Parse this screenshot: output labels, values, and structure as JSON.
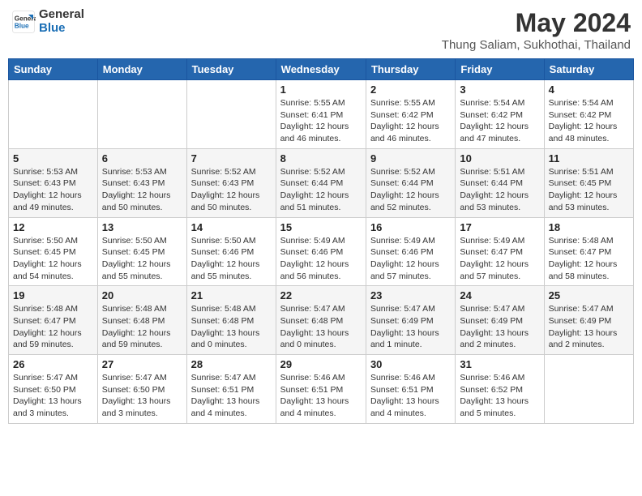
{
  "header": {
    "logo_general": "General",
    "logo_blue": "Blue",
    "main_title": "May 2024",
    "subtitle": "Thung Saliam, Sukhothai, Thailand"
  },
  "calendar": {
    "days_of_week": [
      "Sunday",
      "Monday",
      "Tuesday",
      "Wednesday",
      "Thursday",
      "Friday",
      "Saturday"
    ],
    "weeks": [
      [
        {
          "day": "",
          "info": ""
        },
        {
          "day": "",
          "info": ""
        },
        {
          "day": "",
          "info": ""
        },
        {
          "day": "1",
          "info": "Sunrise: 5:55 AM\nSunset: 6:41 PM\nDaylight: 12 hours\nand 46 minutes."
        },
        {
          "day": "2",
          "info": "Sunrise: 5:55 AM\nSunset: 6:42 PM\nDaylight: 12 hours\nand 46 minutes."
        },
        {
          "day": "3",
          "info": "Sunrise: 5:54 AM\nSunset: 6:42 PM\nDaylight: 12 hours\nand 47 minutes."
        },
        {
          "day": "4",
          "info": "Sunrise: 5:54 AM\nSunset: 6:42 PM\nDaylight: 12 hours\nand 48 minutes."
        }
      ],
      [
        {
          "day": "5",
          "info": "Sunrise: 5:53 AM\nSunset: 6:43 PM\nDaylight: 12 hours\nand 49 minutes."
        },
        {
          "day": "6",
          "info": "Sunrise: 5:53 AM\nSunset: 6:43 PM\nDaylight: 12 hours\nand 50 minutes."
        },
        {
          "day": "7",
          "info": "Sunrise: 5:52 AM\nSunset: 6:43 PM\nDaylight: 12 hours\nand 50 minutes."
        },
        {
          "day": "8",
          "info": "Sunrise: 5:52 AM\nSunset: 6:44 PM\nDaylight: 12 hours\nand 51 minutes."
        },
        {
          "day": "9",
          "info": "Sunrise: 5:52 AM\nSunset: 6:44 PM\nDaylight: 12 hours\nand 52 minutes."
        },
        {
          "day": "10",
          "info": "Sunrise: 5:51 AM\nSunset: 6:44 PM\nDaylight: 12 hours\nand 53 minutes."
        },
        {
          "day": "11",
          "info": "Sunrise: 5:51 AM\nSunset: 6:45 PM\nDaylight: 12 hours\nand 53 minutes."
        }
      ],
      [
        {
          "day": "12",
          "info": "Sunrise: 5:50 AM\nSunset: 6:45 PM\nDaylight: 12 hours\nand 54 minutes."
        },
        {
          "day": "13",
          "info": "Sunrise: 5:50 AM\nSunset: 6:45 PM\nDaylight: 12 hours\nand 55 minutes."
        },
        {
          "day": "14",
          "info": "Sunrise: 5:50 AM\nSunset: 6:46 PM\nDaylight: 12 hours\nand 55 minutes."
        },
        {
          "day": "15",
          "info": "Sunrise: 5:49 AM\nSunset: 6:46 PM\nDaylight: 12 hours\nand 56 minutes."
        },
        {
          "day": "16",
          "info": "Sunrise: 5:49 AM\nSunset: 6:46 PM\nDaylight: 12 hours\nand 57 minutes."
        },
        {
          "day": "17",
          "info": "Sunrise: 5:49 AM\nSunset: 6:47 PM\nDaylight: 12 hours\nand 57 minutes."
        },
        {
          "day": "18",
          "info": "Sunrise: 5:48 AM\nSunset: 6:47 PM\nDaylight: 12 hours\nand 58 minutes."
        }
      ],
      [
        {
          "day": "19",
          "info": "Sunrise: 5:48 AM\nSunset: 6:47 PM\nDaylight: 12 hours\nand 59 minutes."
        },
        {
          "day": "20",
          "info": "Sunrise: 5:48 AM\nSunset: 6:48 PM\nDaylight: 12 hours\nand 59 minutes."
        },
        {
          "day": "21",
          "info": "Sunrise: 5:48 AM\nSunset: 6:48 PM\nDaylight: 13 hours\nand 0 minutes."
        },
        {
          "day": "22",
          "info": "Sunrise: 5:47 AM\nSunset: 6:48 PM\nDaylight: 13 hours\nand 0 minutes."
        },
        {
          "day": "23",
          "info": "Sunrise: 5:47 AM\nSunset: 6:49 PM\nDaylight: 13 hours\nand 1 minute."
        },
        {
          "day": "24",
          "info": "Sunrise: 5:47 AM\nSunset: 6:49 PM\nDaylight: 13 hours\nand 2 minutes."
        },
        {
          "day": "25",
          "info": "Sunrise: 5:47 AM\nSunset: 6:49 PM\nDaylight: 13 hours\nand 2 minutes."
        }
      ],
      [
        {
          "day": "26",
          "info": "Sunrise: 5:47 AM\nSunset: 6:50 PM\nDaylight: 13 hours\nand 3 minutes."
        },
        {
          "day": "27",
          "info": "Sunrise: 5:47 AM\nSunset: 6:50 PM\nDaylight: 13 hours\nand 3 minutes."
        },
        {
          "day": "28",
          "info": "Sunrise: 5:47 AM\nSunset: 6:51 PM\nDaylight: 13 hours\nand 4 minutes."
        },
        {
          "day": "29",
          "info": "Sunrise: 5:46 AM\nSunset: 6:51 PM\nDaylight: 13 hours\nand 4 minutes."
        },
        {
          "day": "30",
          "info": "Sunrise: 5:46 AM\nSunset: 6:51 PM\nDaylight: 13 hours\nand 4 minutes."
        },
        {
          "day": "31",
          "info": "Sunrise: 5:46 AM\nSunset: 6:52 PM\nDaylight: 13 hours\nand 5 minutes."
        },
        {
          "day": "",
          "info": ""
        }
      ]
    ]
  }
}
